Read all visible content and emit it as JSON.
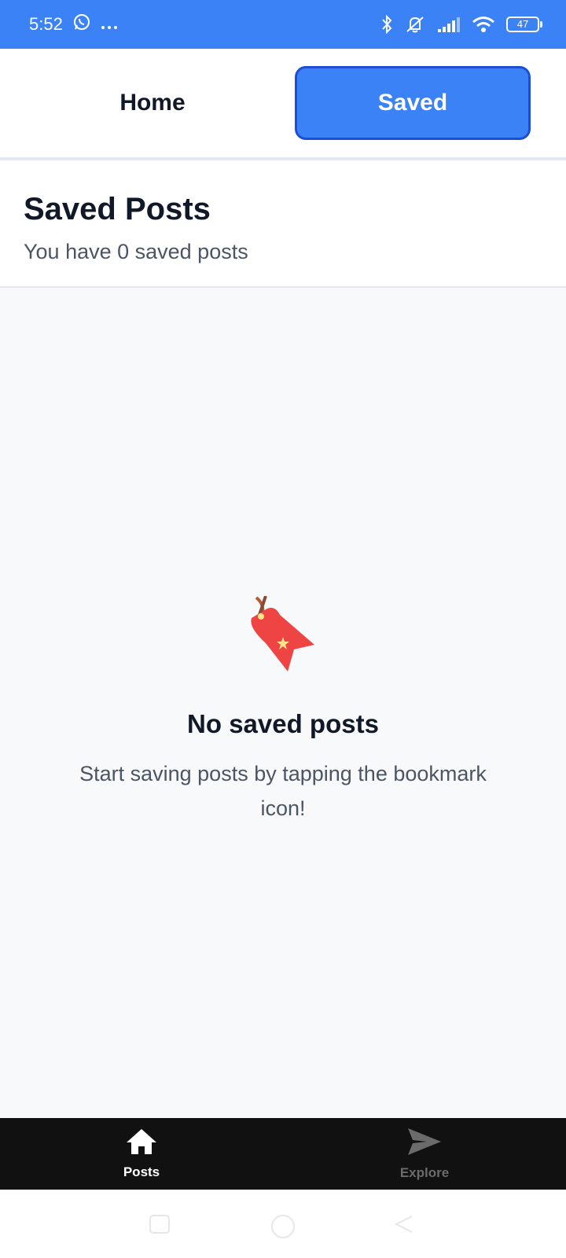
{
  "status_bar": {
    "time": "5:52",
    "battery": "47",
    "icons": [
      "whatsapp-icon",
      "more-dots-icon",
      "bluetooth-icon",
      "mute-icon",
      "signal-icon",
      "wifi-icon",
      "battery-icon"
    ]
  },
  "tabs": {
    "home_label": "Home",
    "saved_label": "Saved",
    "active": "Saved"
  },
  "header": {
    "title": "Saved Posts",
    "subtitle": "You have 0 saved posts"
  },
  "empty_state": {
    "icon": "bookmark-tag-icon",
    "title": "No saved posts",
    "message": "Start saving posts by tapping the bookmark icon!"
  },
  "bottom_nav": {
    "items": [
      {
        "label": "Posts",
        "icon": "home-icon",
        "active": true
      },
      {
        "label": "Explore",
        "icon": "send-icon",
        "active": false
      }
    ]
  },
  "colors": {
    "accent": "#3b82f6",
    "accent_border": "#1d4ed8",
    "nav_bg": "#111111",
    "tag_red": "#ef4444"
  }
}
